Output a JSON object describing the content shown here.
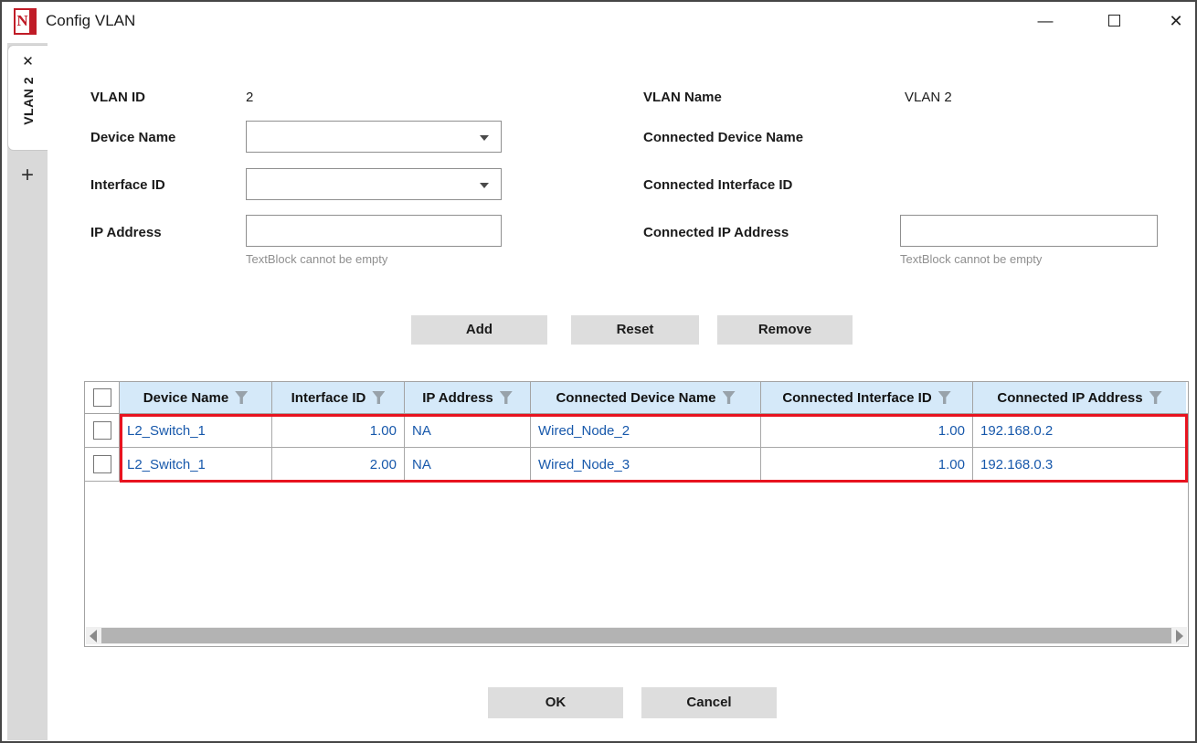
{
  "window": {
    "title": "Config VLAN",
    "minimize_icon": "—",
    "close_icon": "✕",
    "logo_letter": "N"
  },
  "sidebar": {
    "tab": {
      "label": "VLAN 2",
      "close_icon": "✕"
    },
    "add_tab_icon": "+"
  },
  "form": {
    "left": {
      "vlan_id": {
        "label": "VLAN ID",
        "value": "2"
      },
      "device_name": {
        "label": "Device Name",
        "value": ""
      },
      "interface_id": {
        "label": "Interface ID",
        "value": ""
      },
      "ip_address": {
        "label": "IP Address",
        "value": "",
        "validation": "TextBlock cannot be empty"
      }
    },
    "right": {
      "vlan_name": {
        "label": "VLAN Name",
        "value": "VLAN 2"
      },
      "connected_device_name": {
        "label": "Connected Device Name",
        "value": ""
      },
      "connected_interface_id": {
        "label": "Connected Interface ID",
        "value": ""
      },
      "connected_ip_address": {
        "label": "Connected IP Address",
        "value": "",
        "validation": "TextBlock cannot be empty"
      }
    }
  },
  "actions": {
    "add": "Add",
    "reset": "Reset",
    "remove": "Remove"
  },
  "grid": {
    "columns": [
      "Device Name",
      "Interface ID",
      "IP Address",
      "Connected Device Name",
      "Connected Interface ID",
      "Connected IP Address"
    ],
    "rows": [
      {
        "cells": [
          "L2_Switch_1",
          "1.00",
          "NA",
          "Wired_Node_2",
          "1.00",
          "192.168.0.2"
        ]
      },
      {
        "cells": [
          "L2_Switch_1",
          "2.00",
          "NA",
          "Wired_Node_3",
          "1.00",
          "192.168.0.3"
        ]
      }
    ]
  },
  "footer": {
    "ok": "OK",
    "cancel": "Cancel"
  },
  "colors": {
    "header_bg": "#d5e9f9",
    "grid_text": "#1758ab",
    "highlight_border": "#e8131f",
    "button_bg": "#dddddd",
    "sidebar_bg": "#d9d9d9",
    "logo_red": "#c01c27"
  }
}
